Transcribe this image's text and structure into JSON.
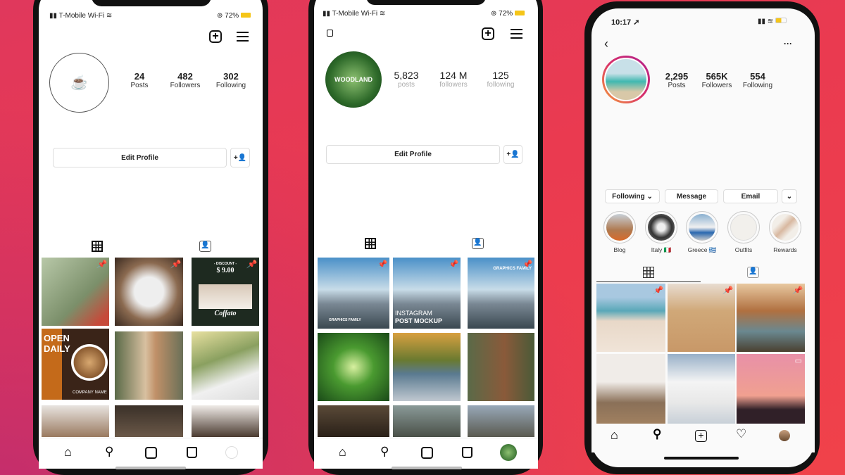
{
  "phones": [
    {
      "status": {
        "carrier": "T-Mobile Wi-Fi",
        "battery": "72%"
      },
      "stats": [
        {
          "value": "24",
          "label": "Posts"
        },
        {
          "value": "482",
          "label": "Followers"
        },
        {
          "value": "302",
          "label": "Following"
        }
      ],
      "edit_profile": "Edit Profile",
      "tiles": [
        "",
        "",
        "DISCOUNT $9.00 Coffato",
        "OPEN DAILY",
        "",
        "",
        "",
        "",
        ""
      ],
      "tile_extra": {
        "open": "OPEN",
        "daily": "DAILY",
        "company": "COMPANY NAME",
        "discount": "- DISCOUNT -",
        "price": "$ 9.00",
        "brand": "Coffato"
      }
    },
    {
      "status": {
        "carrier": "T-Mobile Wi-Fi",
        "battery": "72%"
      },
      "avatar_logo": "WOODLAND",
      "stats": [
        {
          "value": "5,823",
          "label": "posts"
        },
        {
          "value": "124 M",
          "label": "followers"
        },
        {
          "value": "125",
          "label": "following"
        }
      ],
      "edit_profile": "Edit Profile",
      "tile_extra": {
        "gf1": "GRAPHICS FAMILY",
        "mock1": "INSTAGRAM",
        "mock2": "POST MOCKUP",
        "gf2": "GRAPHICS FAMILY"
      }
    },
    {
      "status": {
        "time": "10:17"
      },
      "stats": [
        {
          "value": "2,295",
          "label": "Posts"
        },
        {
          "value": "565K",
          "label": "Followers"
        },
        {
          "value": "554",
          "label": "Following"
        }
      ],
      "buttons": {
        "following": "Following ⌄",
        "message": "Message",
        "email": "Email",
        "more": "⌄"
      },
      "highlights": [
        "Blog",
        "Italy 🇮🇹",
        "Greece 🇬🇷",
        "Outfits",
        "Rewards"
      ]
    }
  ],
  "colors": {
    "accent_ring_start": "#f7a23a",
    "accent_ring_end": "#b0208e",
    "background": "#e83a50"
  }
}
